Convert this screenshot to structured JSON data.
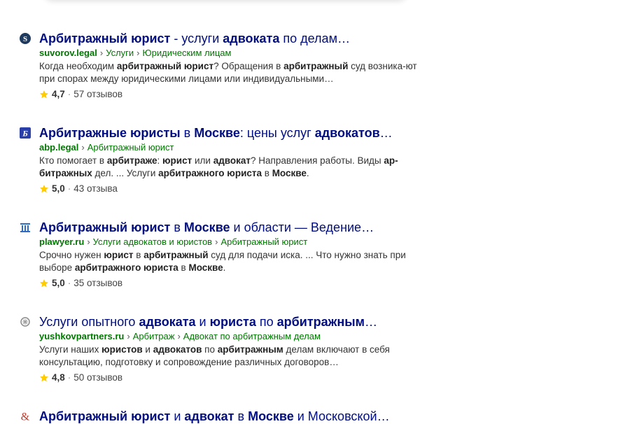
{
  "results": [
    {
      "favicon": "suvorov-s-icon",
      "title_parts": [
        {
          "t": "Арбитражный юрист",
          "b": true
        },
        {
          "t": " - услуги ",
          "b": false
        },
        {
          "t": "адвоката",
          "b": true
        },
        {
          "t": " по делам…",
          "b": false
        }
      ],
      "host": "suvorov.legal",
      "breadcrumbs": [
        "Услуги",
        "Юридическим лицам"
      ],
      "snippet_parts": [
        {
          "t": "Когда необходим ",
          "b": false
        },
        {
          "t": "арбитражный юрист",
          "b": true
        },
        {
          "t": "? Обращения в ",
          "b": false
        },
        {
          "t": "арбитражный",
          "b": true
        },
        {
          "t": " суд возника-ют при спорах между юридическими лицами или индивидуальными…",
          "b": false
        }
      ],
      "rating": "4,7",
      "reviews": "57 отзывов"
    },
    {
      "favicon": "abp-b-icon",
      "title_parts": [
        {
          "t": "Арбитражные юристы",
          "b": true
        },
        {
          "t": " в ",
          "b": false
        },
        {
          "t": "Москве",
          "b": true
        },
        {
          "t": ": цены услуг ",
          "b": false
        },
        {
          "t": "адвокатов",
          "b": true
        },
        {
          "t": "…",
          "b": false
        }
      ],
      "host": "abp.legal",
      "breadcrumbs": [
        "Арбитражный юрист"
      ],
      "snippet_parts": [
        {
          "t": "Кто помогает в ",
          "b": false
        },
        {
          "t": "арбитраже",
          "b": true
        },
        {
          "t": ": ",
          "b": false
        },
        {
          "t": "юрист",
          "b": true
        },
        {
          "t": " или ",
          "b": false
        },
        {
          "t": "адвокат",
          "b": true
        },
        {
          "t": "? Направления работы. Виды ",
          "b": false
        },
        {
          "t": "ар-битражных",
          "b": true
        },
        {
          "t": " дел. ... Услуги ",
          "b": false
        },
        {
          "t": "арбитражного юриста",
          "b": true
        },
        {
          "t": " в ",
          "b": false
        },
        {
          "t": "Москве",
          "b": true
        },
        {
          "t": ".",
          "b": false
        }
      ],
      "rating": "5,0",
      "reviews": "43 отзыва"
    },
    {
      "favicon": "plawyer-pillar-icon",
      "title_parts": [
        {
          "t": "Арбитражный юрист",
          "b": true
        },
        {
          "t": " в ",
          "b": false
        },
        {
          "t": "Москве",
          "b": true
        },
        {
          "t": " и области — Ведение…",
          "b": false
        }
      ],
      "host": "plawyer.ru",
      "breadcrumbs": [
        "Услуги адвокатов и юристов",
        "Арбитражный юрист"
      ],
      "snippet_parts": [
        {
          "t": "Срочно нужен ",
          "b": false
        },
        {
          "t": "юрист",
          "b": true
        },
        {
          "t": " в ",
          "b": false
        },
        {
          "t": "арбитражный",
          "b": true
        },
        {
          "t": " суд для подачи иска. ... Что нужно знать при выборе ",
          "b": false
        },
        {
          "t": "арбитражного юриста",
          "b": true
        },
        {
          "t": " в ",
          "b": false
        },
        {
          "t": "Москве",
          "b": true
        },
        {
          "t": ".",
          "b": false
        }
      ],
      "rating": "5,0",
      "reviews": "35 отзывов"
    },
    {
      "favicon": "yushkov-emblem-icon",
      "title_parts": [
        {
          "t": "Услуги опытного ",
          "b": false
        },
        {
          "t": "адвоката",
          "b": true
        },
        {
          "t": " и ",
          "b": false
        },
        {
          "t": "юриста",
          "b": true
        },
        {
          "t": " по ",
          "b": false
        },
        {
          "t": "арбитражным",
          "b": true
        },
        {
          "t": "…",
          "b": false
        }
      ],
      "host": "yushkovpartners.ru",
      "breadcrumbs": [
        "Арбитраж",
        "Адвокат по арбитражным делам"
      ],
      "snippet_parts": [
        {
          "t": "Услуги наших ",
          "b": false
        },
        {
          "t": "юристов",
          "b": true
        },
        {
          "t": " и ",
          "b": false
        },
        {
          "t": "адвокатов",
          "b": true
        },
        {
          "t": " по ",
          "b": false
        },
        {
          "t": "арбитражным",
          "b": true
        },
        {
          "t": " делам включают в себя консультацию, подготовку и сопровождение различных договоров…",
          "b": false
        }
      ],
      "rating": "4,8",
      "reviews": "50 отзывов"
    },
    {
      "favicon": "ampersand-icon",
      "title_parts": [
        {
          "t": "Арбитражный юрист",
          "b": true
        },
        {
          "t": " и ",
          "b": false
        },
        {
          "t": "адвокат",
          "b": true
        },
        {
          "t": " в ",
          "b": false
        },
        {
          "t": "Москве",
          "b": true
        },
        {
          "t": " и Московской…",
          "b": false
        }
      ]
    }
  ],
  "colors": {
    "title": "#000d80",
    "path": "#007700",
    "star": "#ffcc00"
  }
}
